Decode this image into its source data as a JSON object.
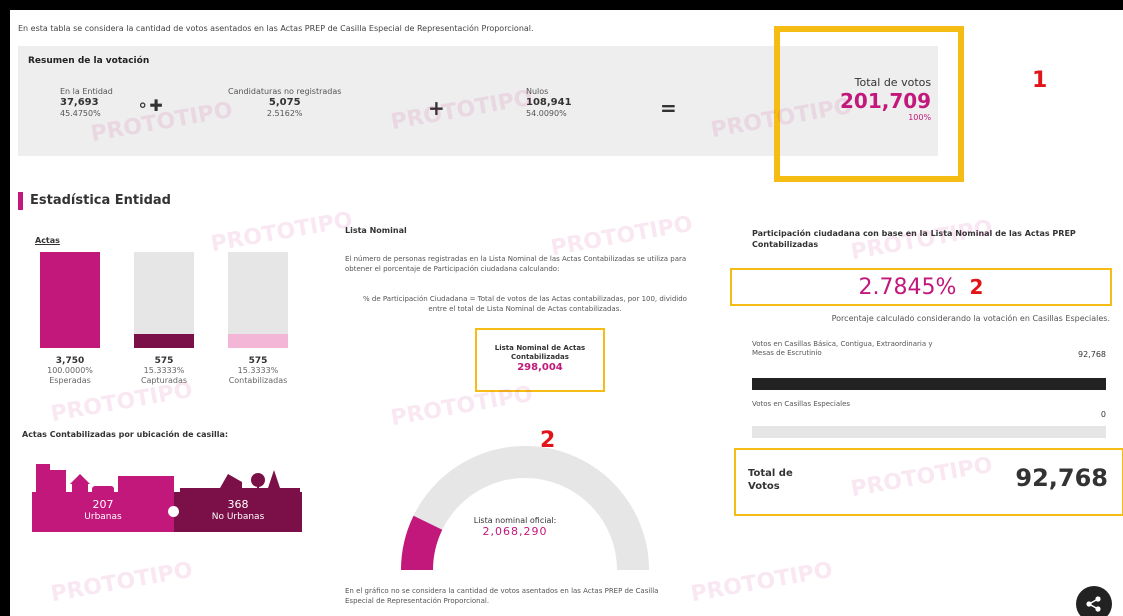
{
  "intro_text": "En esta tabla se considera la cantidad de votos asentados en las Actas PREP de Casilla Especial de Representación Proporcional.",
  "summary": {
    "title": "Resumen de la votación",
    "entidad": {
      "label": "En la Entidad",
      "value": "37,693",
      "pct": "45.4750%"
    },
    "no_registradas": {
      "label": "Candidaturas no registradas",
      "value": "5,075",
      "pct": "2.5162%"
    },
    "nulos": {
      "label": "Nulos",
      "value": "108,941",
      "pct": "54.0090%"
    },
    "total_label": "Total de votos",
    "total_value": "201,709",
    "total_pct": "100%"
  },
  "annotations": {
    "one": "1",
    "two_a": "2",
    "two_b": "2"
  },
  "section_title": "Estadística Entidad",
  "actas": {
    "label": "Actas",
    "bars": [
      {
        "value": "3,750",
        "pct": "100.0000%",
        "name": "Esperadas",
        "fill": 1.0,
        "color": "#c2187b"
      },
      {
        "value": "575",
        "pct": "15.3333%",
        "name": "Capturadas",
        "fill": 0.15,
        "color": "#7b1048"
      },
      {
        "value": "575",
        "pct": "15.3333%",
        "name": "Contabilizadas",
        "fill": 0.15,
        "color": "#f4b6d6"
      }
    ]
  },
  "ubicacion": {
    "title": "Actas Contabilizadas por ubicación de casilla:",
    "urbanas": {
      "value": "207",
      "label": "Urbanas"
    },
    "no_urbanas": {
      "value": "368",
      "label": "No Urbanas"
    }
  },
  "lista_nominal": {
    "title": "Lista Nominal",
    "description": "El número de personas registradas en la Lista Nominal de las Actas Contabilizadas se utiliza para obtener el porcentaje de Participación ciudadana calculando:",
    "formula": "% de Participación Ciudadana = Total de votos de las Actas contabilizadas, por 100, dividido entre el total de Lista Nominal de Actas contabilizadas.",
    "box_title": "Lista Nominal de Actas Contabilizadas",
    "box_value": "298,004",
    "gauge_label": "Lista nominal oficial:",
    "gauge_value": "2,068,290",
    "gauge_fill": 0.144,
    "note": "En el gráfico no se considera la cantidad de votos asentados en las Actas PREP de Casilla Especial de Representación Proporcional."
  },
  "participacion": {
    "title": "Participación ciudadana con base en la Lista Nominal de las Actas PREP Contabilizadas",
    "value": "2.7845%",
    "note": "Porcentaje calculado considerando la votación en Casillas Especiales.",
    "row1_label": "Votos en Casillas Básica, Contigua, Extraordinaria y Mesas de Escrutinio",
    "row1_value": "92,768",
    "row2_label": "Votos en Casillas Especiales",
    "row2_value": "0",
    "total_label": "Total de Votos",
    "total_value": "92,768"
  },
  "watermark": "PROTOTIPO",
  "colors": {
    "accent": "#c2187b",
    "dark_accent": "#7b1048",
    "highlight": "#f5bc14",
    "marker": "#e2141a"
  }
}
